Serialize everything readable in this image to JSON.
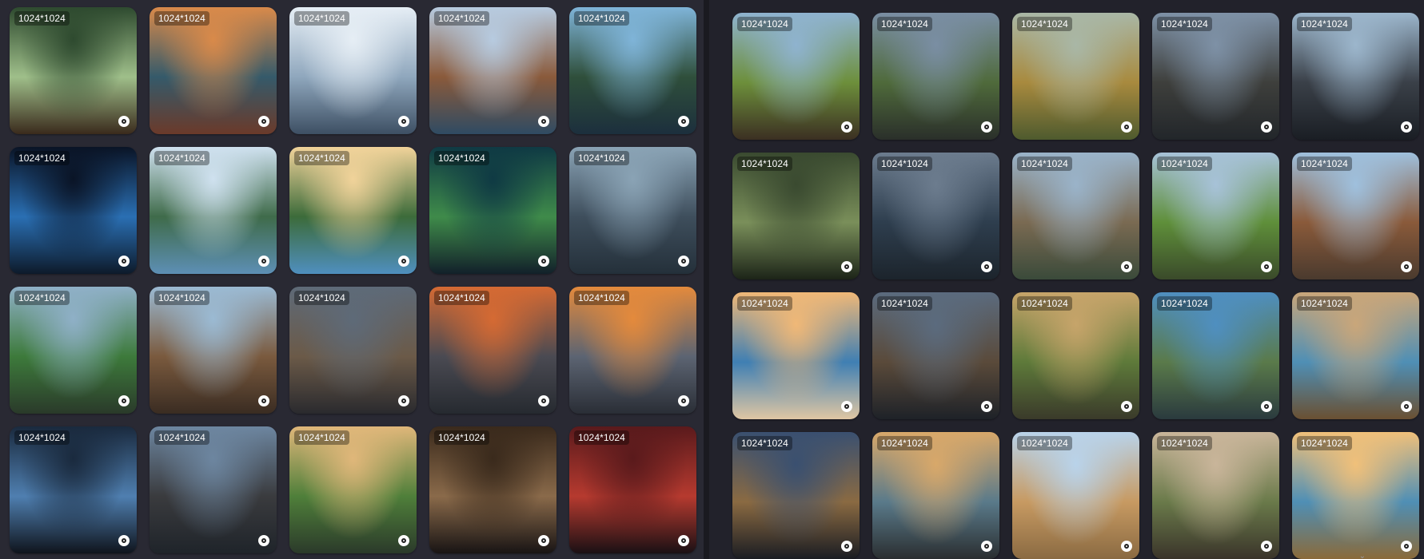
{
  "left_panel": {
    "images": [
      {
        "size": "1024*1024",
        "theme": "forest-path",
        "c1": "#2e4a2f",
        "c2": "#9fbf8a",
        "c3": "#3a2a1c"
      },
      {
        "size": "1024*1024",
        "theme": "sunset-stream-flowers",
        "c1": "#d98a4a",
        "c2": "#355a6a",
        "c3": "#6b3a2a"
      },
      {
        "size": "1024*1024",
        "theme": "snowy-mountains",
        "c1": "#e6eef5",
        "c2": "#8fa7bd",
        "c3": "#3d4f63"
      },
      {
        "size": "1024*1024",
        "theme": "canal-town",
        "c1": "#b7cbe0",
        "c2": "#8a5a3b",
        "c3": "#2f4b63"
      },
      {
        "size": "1024*1024",
        "theme": "forest-lake",
        "c1": "#7fb4d8",
        "c2": "#2f4f3b",
        "c3": "#1c2f3d"
      },
      {
        "size": "1024*1024",
        "theme": "blue-waterfall-cave",
        "c1": "#0a1426",
        "c2": "#2a6fb3",
        "c3": "#0d1a2a"
      },
      {
        "size": "1024*1024",
        "theme": "lake-reflection",
        "c1": "#cfe1ef",
        "c2": "#3f6b4a",
        "c3": "#5d8fb5"
      },
      {
        "size": "1024*1024",
        "theme": "pine-lake-sunny",
        "c1": "#f1d39a",
        "c2": "#3c6b3a",
        "c3": "#4f8fbf"
      },
      {
        "size": "1024*1024",
        "theme": "tree-night-meadow",
        "c1": "#0f3a44",
        "c2": "#3f8b4a",
        "c3": "#12202a"
      },
      {
        "size": "1024*1024",
        "theme": "misty-forest",
        "c1": "#8aa3b5",
        "c2": "#3e4e5c",
        "c3": "#24303a"
      },
      {
        "size": "1024*1024",
        "theme": "lone-tree-mountains",
        "c1": "#8fb0c7",
        "c2": "#3d7a3b",
        "c3": "#2a3a2a"
      },
      {
        "size": "1024*1024",
        "theme": "medieval-street",
        "c1": "#9bbad3",
        "c2": "#7a5a3e",
        "c3": "#3a2c22"
      },
      {
        "size": "1024*1024",
        "theme": "stormy-village",
        "c1": "#5e6a78",
        "c2": "#6b5a48",
        "c3": "#2a2a2e"
      },
      {
        "size": "1024*1024",
        "theme": "burning-village",
        "c1": "#d56a33",
        "c2": "#4a4a52",
        "c3": "#262a30"
      },
      {
        "size": "1024*1024",
        "theme": "fire-sky-village",
        "c1": "#e48a3c",
        "c2": "#5c6472",
        "c3": "#2a2e36"
      },
      {
        "size": "1024*1024",
        "theme": "dark-hall",
        "c1": "#1a2a3e",
        "c2": "#4f7fb0",
        "c3": "#0f141c"
      },
      {
        "size": "1024*1024",
        "theme": "dusk-village",
        "c1": "#6d86a0",
        "c2": "#3a3b3e",
        "c3": "#1f242a"
      },
      {
        "size": "1024*1024",
        "theme": "green-valley",
        "c1": "#e0b77a",
        "c2": "#4f7f3a",
        "c3": "#2b3a2a"
      },
      {
        "size": "1024*1024",
        "theme": "stone-bedroom",
        "c1": "#3a2a1c",
        "c2": "#8a6a4a",
        "c3": "#181414"
      },
      {
        "size": "1024*1024",
        "theme": "red-bedroom",
        "c1": "#5a1a1c",
        "c2": "#b63a2f",
        "c3": "#1a1014"
      }
    ]
  },
  "right_panel": {
    "images": [
      {
        "size": "1024*1024",
        "theme": "stump-valley",
        "c1": "#8fb3cf",
        "c2": "#6d8f3b",
        "c3": "#3b2f22"
      },
      {
        "size": "1024*1024",
        "theme": "standing-stone",
        "c1": "#7a8ea3",
        "c2": "#4f6a3b",
        "c3": "#2a2f2a"
      },
      {
        "size": "1024*1024",
        "theme": "grass-path-hills",
        "c1": "#a9b7a6",
        "c2": "#a88a3e",
        "c3": "#4e5a2e"
      },
      {
        "size": "1024*1024",
        "theme": "stormy-manor",
        "c1": "#7e91a6",
        "c2": "#3e3f3c",
        "c3": "#22262a"
      },
      {
        "size": "1024*1024",
        "theme": "ruined-colonnade",
        "c1": "#9cb6cc",
        "c2": "#3a4048",
        "c3": "#1a1e24"
      },
      {
        "size": "1024*1024",
        "theme": "cave-mouth",
        "c1": "#3a4a30",
        "c2": "#7a8f5a",
        "c3": "#1c2418"
      },
      {
        "size": "1024*1024",
        "theme": "ship-in-storm",
        "c1": "#6c7c8e",
        "c2": "#2e3e4e",
        "c3": "#1c242c"
      },
      {
        "size": "1024*1024",
        "theme": "rocky-coast",
        "c1": "#9ab3c9",
        "c2": "#7a6a52",
        "c3": "#3a4a3a"
      },
      {
        "size": "1024*1024",
        "theme": "river-meadow",
        "c1": "#a7c2d8",
        "c2": "#5f8f3a",
        "c3": "#3a4a2a"
      },
      {
        "size": "1024*1024",
        "theme": "village-street",
        "c1": "#9fc0dd",
        "c2": "#8a5a3a",
        "c3": "#4a3a2e"
      },
      {
        "size": "1024*1024",
        "theme": "sunset-beach",
        "c1": "#f0b877",
        "c2": "#3f7fb3",
        "c3": "#dfc6a3"
      },
      {
        "size": "1024*1024",
        "theme": "haunted-houses",
        "c1": "#5b6b7e",
        "c2": "#5a4a3a",
        "c3": "#1e2228"
      },
      {
        "size": "1024*1024",
        "theme": "valley-flowers",
        "c1": "#c6a46a",
        "c2": "#5e7a3a",
        "c3": "#3a3a2a"
      },
      {
        "size": "1024*1024",
        "theme": "cliff-coast",
        "c1": "#4f8fc0",
        "c2": "#5a7a4a",
        "c3": "#2a3a3e"
      },
      {
        "size": "1024*1024",
        "theme": "winding-river",
        "c1": "#c9a67a",
        "c2": "#4f8fb5",
        "c3": "#6a5032"
      },
      {
        "size": "1024*1024",
        "theme": "night-village-square",
        "c1": "#3a5070",
        "c2": "#8a6a42",
        "c3": "#1a1c22"
      },
      {
        "size": "1024*1024",
        "theme": "spiral-terraces",
        "c1": "#d8a86a",
        "c2": "#5a7a8a",
        "c3": "#2a2e30"
      },
      {
        "size": "1024*1024",
        "theme": "desert-dunes",
        "c1": "#b9d3ea",
        "c2": "#c79a62",
        "c3": "#8a6a42"
      },
      {
        "size": "1024*1024",
        "theme": "town-plain",
        "c1": "#c9b59a",
        "c2": "#6a7a4a",
        "c3": "#3a342a"
      },
      {
        "size": "1024*1024",
        "theme": "river-savanna",
        "c1": "#f0c07a",
        "c2": "#4f8fb5",
        "c3": "#8a6a3a"
      }
    ]
  }
}
